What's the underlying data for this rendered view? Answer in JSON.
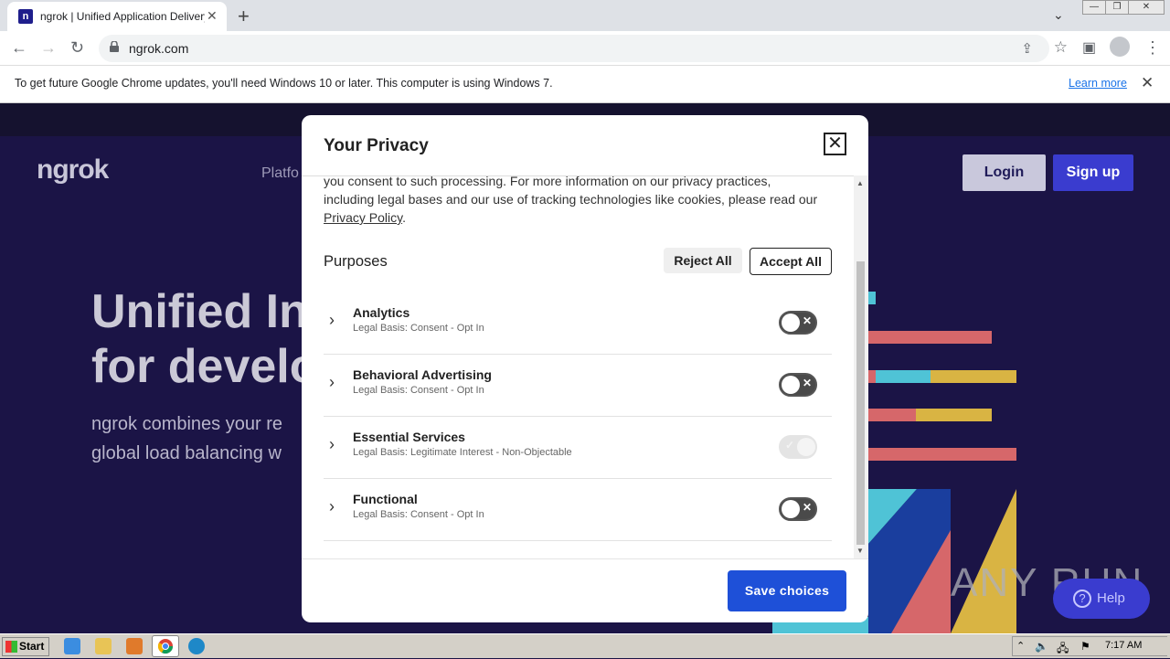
{
  "browser": {
    "tab_title": "ngrok | Unified Application Delivery P",
    "tab_favicon": "n",
    "url": "ngrok.com",
    "infobar_message": "To get future Google Chrome updates, you'll need Windows 10 or later. This computer is using Windows 7.",
    "infobar_link": "Learn more"
  },
  "page": {
    "logo": "ngrok",
    "nav_item": "Platfo",
    "login": "Login",
    "signup": "Sign up",
    "hero_line1": "Unified In",
    "hero_line2": "for develo",
    "sub_line1": "ngrok combines your re",
    "sub_line2": "global load balancing w",
    "help": "Help"
  },
  "modal": {
    "title": "Your Privacy",
    "intro_line1": "you consent to such processing. For more information on our privacy practices,",
    "intro_line2": "including legal bases and our use of tracking technologies like cookies, please read our",
    "policy_link": "Privacy Policy",
    "purposes_heading": "Purposes",
    "reject_all": "Reject All",
    "accept_all": "Accept All",
    "purposes": [
      {
        "name": "Analytics",
        "basis": "Legal Basis: Consent - Opt In",
        "enabled": false,
        "disabled": false
      },
      {
        "name": "Behavioral Advertising",
        "basis": "Legal Basis: Consent - Opt In",
        "enabled": false,
        "disabled": false
      },
      {
        "name": "Essential Services",
        "basis": "Legal Basis: Legitimate Interest - Non-Objectable",
        "enabled": true,
        "disabled": true
      },
      {
        "name": "Functional",
        "basis": "Legal Basis: Consent - Opt In",
        "enabled": false,
        "disabled": false
      }
    ],
    "save_choices": "Save choices"
  },
  "taskbar": {
    "start": "Start",
    "clock": "7:17 AM"
  },
  "watermark": "ANY RUN",
  "colors": {
    "page_bg": "#1b1446",
    "primary_button": "#1e50d8",
    "signup_button": "#3a3ccf"
  }
}
